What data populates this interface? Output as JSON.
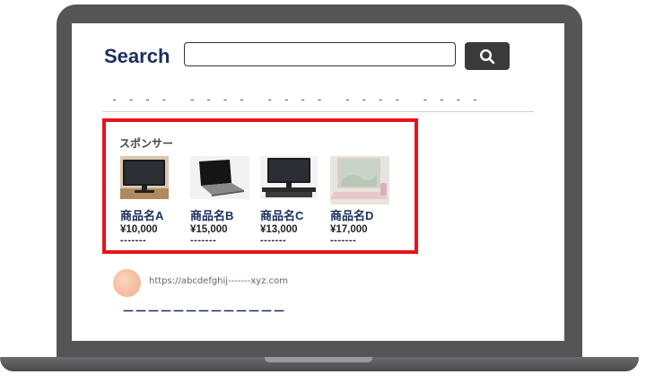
{
  "search": {
    "label": "Search",
    "value": "",
    "placeholder": ""
  },
  "nav": {
    "tabs": [
      "- - - -",
      "- - - -",
      "- - - -",
      "- - - -",
      "- - - -"
    ]
  },
  "sponsor": {
    "title": "スポンサー",
    "products": [
      {
        "name": "商品名A",
        "price": "¥10,000",
        "desc": "-------",
        "image": "monitor"
      },
      {
        "name": "商品名B",
        "price": "¥15,000",
        "desc": "-------",
        "image": "laptop-dark"
      },
      {
        "name": "商品名C",
        "price": "¥13,000",
        "desc": "-------",
        "image": "monitor-stand"
      },
      {
        "name": "商品名D",
        "price": "¥17,000",
        "desc": "-------",
        "image": "laptop-pink"
      }
    ]
  },
  "result": {
    "url": "https://abcdefghij-------xyz.com",
    "title": "－－－－－－－－－－－－－"
  },
  "colors": {
    "accent": "#1a2e5c",
    "sponsor_border": "#e8141b",
    "button": "#3a3a3a"
  }
}
